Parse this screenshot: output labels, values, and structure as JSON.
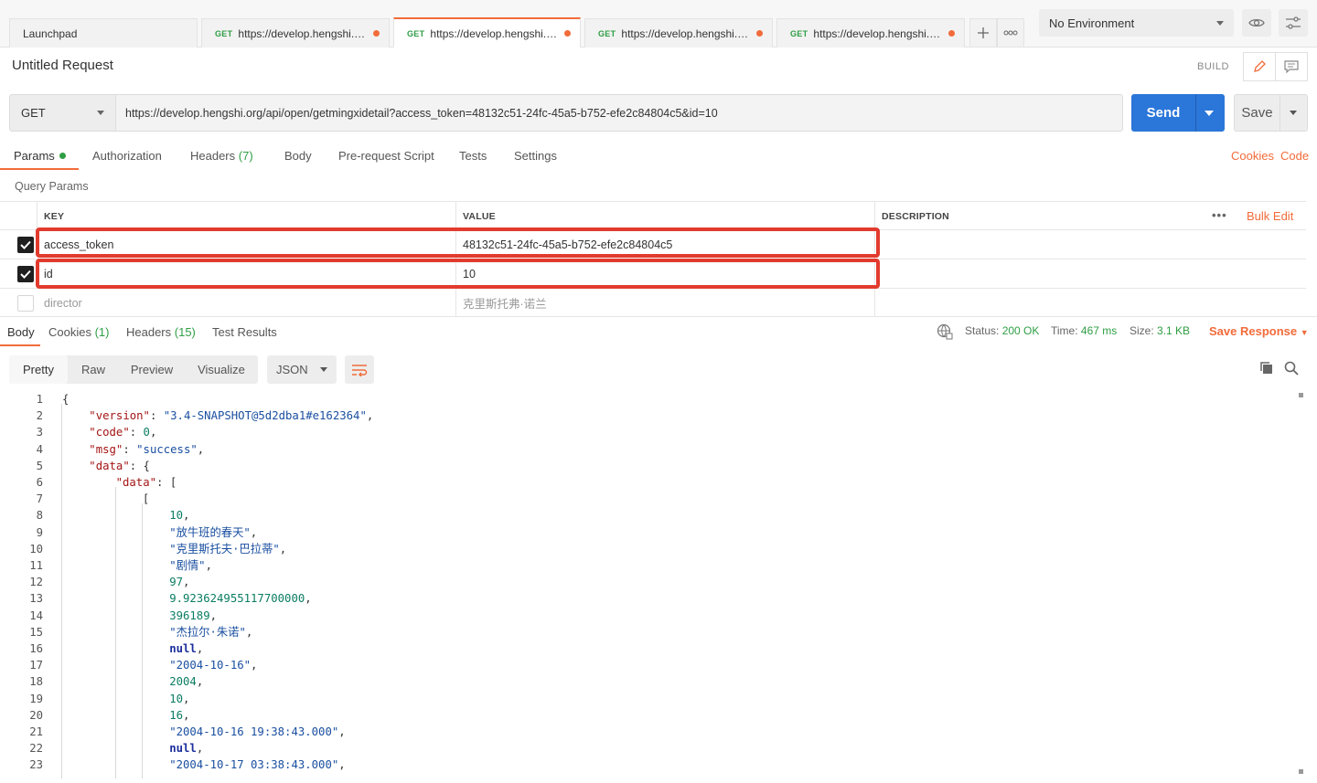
{
  "tabs": {
    "launchpad": "Launchpad",
    "items": [
      {
        "method": "GET",
        "url": "https://develop.hengshi.org..."
      },
      {
        "method": "GET",
        "url": "https://develop.hengshi.org..."
      },
      {
        "method": "GET",
        "url": "https://develop.hengshi.org..."
      },
      {
        "method": "GET",
        "url": "https://develop.hengshi.org..."
      }
    ]
  },
  "environment": {
    "selected": "No Environment"
  },
  "request": {
    "title": "Untitled Request",
    "build_label": "BUILD",
    "method": "GET",
    "url": "https://develop.hengshi.org/api/open/getmingxidetail?access_token=48132c51-24fc-45a5-b752-efe2c84804c5&id=10",
    "send_label": "Send",
    "save_label": "Save"
  },
  "request_tabs": {
    "params": "Params",
    "authorization": "Authorization",
    "headers": "Headers",
    "headers_count": "(7)",
    "body": "Body",
    "prerequest": "Pre-request Script",
    "tests": "Tests",
    "settings": "Settings",
    "cookies": "Cookies",
    "code": "Code"
  },
  "params": {
    "section_label": "Query Params",
    "headers": {
      "key": "KEY",
      "value": "VALUE",
      "description": "DESCRIPTION"
    },
    "bulk_edit": "Bulk Edit",
    "rows": [
      {
        "key": "access_token",
        "value": "48132c51-24fc-45a5-b752-efe2c84804c5",
        "checked": true
      },
      {
        "key": "id",
        "value": "10",
        "checked": true
      }
    ],
    "placeholder_row": {
      "key": "director",
      "value": "克里斯托弗·诺兰"
    }
  },
  "response": {
    "tabs": {
      "body": "Body",
      "cookies": "Cookies",
      "cookies_count": "(1)",
      "headers": "Headers",
      "headers_count": "(15)",
      "test_results": "Test Results"
    },
    "status_label": "Status:",
    "status_value": "200 OK",
    "time_label": "Time:",
    "time_value": "467 ms",
    "size_label": "Size:",
    "size_value": "3.1 KB",
    "save_response": "Save Response",
    "format_tabs": [
      "Pretty",
      "Raw",
      "Preview",
      "Visualize"
    ],
    "format_select": "JSON",
    "code_lines": [
      {
        "n": "1",
        "indent": 0,
        "parts": [
          [
            "p",
            "{"
          ]
        ]
      },
      {
        "n": "2",
        "indent": 1,
        "parts": [
          [
            "k",
            "\"version\""
          ],
          [
            "p",
            ": "
          ],
          [
            "s",
            "\"3.4-SNAPSHOT@5d2dba1#e162364\""
          ],
          [
            "p",
            ","
          ]
        ]
      },
      {
        "n": "3",
        "indent": 1,
        "parts": [
          [
            "k",
            "\"code\""
          ],
          [
            "p",
            ": "
          ],
          [
            "n",
            "0"
          ],
          [
            "p",
            ","
          ]
        ]
      },
      {
        "n": "4",
        "indent": 1,
        "parts": [
          [
            "k",
            "\"msg\""
          ],
          [
            "p",
            ": "
          ],
          [
            "s",
            "\"success\""
          ],
          [
            "p",
            ","
          ]
        ]
      },
      {
        "n": "5",
        "indent": 1,
        "parts": [
          [
            "k",
            "\"data\""
          ],
          [
            "p",
            ": {"
          ]
        ]
      },
      {
        "n": "6",
        "indent": 2,
        "parts": [
          [
            "k",
            "\"data\""
          ],
          [
            "p",
            ": ["
          ]
        ]
      },
      {
        "n": "7",
        "indent": 3,
        "parts": [
          [
            "p",
            "["
          ]
        ]
      },
      {
        "n": "8",
        "indent": 4,
        "parts": [
          [
            "n",
            "10"
          ],
          [
            "p",
            ","
          ]
        ]
      },
      {
        "n": "9",
        "indent": 4,
        "parts": [
          [
            "s",
            "\"放牛班的春天\""
          ],
          [
            "p",
            ","
          ]
        ]
      },
      {
        "n": "10",
        "indent": 4,
        "parts": [
          [
            "s",
            "\"克里斯托夫·巴拉蒂\""
          ],
          [
            "p",
            ","
          ]
        ]
      },
      {
        "n": "11",
        "indent": 4,
        "parts": [
          [
            "s",
            "\"剧情\""
          ],
          [
            "p",
            ","
          ]
        ]
      },
      {
        "n": "12",
        "indent": 4,
        "parts": [
          [
            "n",
            "97"
          ],
          [
            "p",
            ","
          ]
        ]
      },
      {
        "n": "13",
        "indent": 4,
        "parts": [
          [
            "n",
            "9.923624955117700000"
          ],
          [
            "p",
            ","
          ]
        ]
      },
      {
        "n": "14",
        "indent": 4,
        "parts": [
          [
            "n",
            "396189"
          ],
          [
            "p",
            ","
          ]
        ]
      },
      {
        "n": "15",
        "indent": 4,
        "parts": [
          [
            "s",
            "\"杰拉尔·朱诺\""
          ],
          [
            "p",
            ","
          ]
        ]
      },
      {
        "n": "16",
        "indent": 4,
        "parts": [
          [
            "kw",
            "null"
          ],
          [
            "p",
            ","
          ]
        ]
      },
      {
        "n": "17",
        "indent": 4,
        "parts": [
          [
            "s",
            "\"2004-10-16\""
          ],
          [
            "p",
            ","
          ]
        ]
      },
      {
        "n": "18",
        "indent": 4,
        "parts": [
          [
            "n",
            "2004"
          ],
          [
            "p",
            ","
          ]
        ]
      },
      {
        "n": "19",
        "indent": 4,
        "parts": [
          [
            "n",
            "10"
          ],
          [
            "p",
            ","
          ]
        ]
      },
      {
        "n": "20",
        "indent": 4,
        "parts": [
          [
            "n",
            "16"
          ],
          [
            "p",
            ","
          ]
        ]
      },
      {
        "n": "21",
        "indent": 4,
        "parts": [
          [
            "s",
            "\"2004-10-16 19:38:43.000\""
          ],
          [
            "p",
            ","
          ]
        ]
      },
      {
        "n": "22",
        "indent": 4,
        "parts": [
          [
            "kw",
            "null"
          ],
          [
            "p",
            ","
          ]
        ]
      },
      {
        "n": "23",
        "indent": 4,
        "parts": [
          [
            "s",
            "\"2004-10-17 03:38:43.000\""
          ],
          [
            "p",
            ","
          ]
        ]
      }
    ]
  },
  "colors": {
    "accent": "#f26b3a",
    "send": "#2b76d9",
    "highlight": "#e23b2e",
    "status_ok": "#2f9e44"
  },
  "icons": [
    "plus-icon",
    "more-icon",
    "eye-icon",
    "sliders-icon",
    "pencil-icon",
    "comment-icon",
    "globe-icon",
    "copy-icon",
    "search-icon",
    "wrap-icon"
  ]
}
